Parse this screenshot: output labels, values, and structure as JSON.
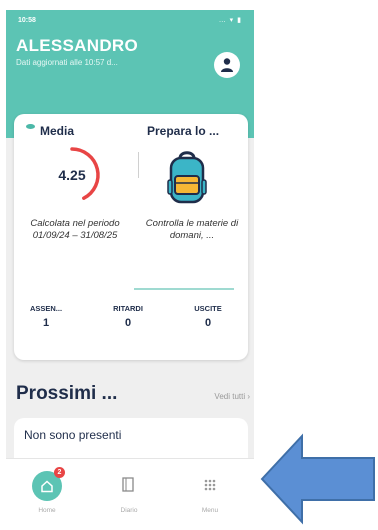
{
  "status_bar": {
    "time": "10:58",
    "icons": "… ▾ ▮"
  },
  "header": {
    "user_name": "ALESSANDRO",
    "updated_text": "Dati aggiornati alle 10:57 d..."
  },
  "media_card": {
    "title": "Media",
    "value": "4.25",
    "value_fraction": 0.425,
    "description": "Calcolata nel periodo 01/09/24 – 31/08/25"
  },
  "prepara_card": {
    "title": "Prepara lo ...",
    "description": "Controlla le materie di domani, ..."
  },
  "stats": [
    {
      "label": "ASSEN...",
      "value": "1"
    },
    {
      "label": "RITARDI",
      "value": "0"
    },
    {
      "label": "USCITE",
      "value": "0"
    }
  ],
  "upcoming": {
    "title": "Prossimi ...",
    "see_all": "Vedi tutti ›",
    "empty_text": "Non sono presenti"
  },
  "bottom_nav": {
    "home_label": "Home",
    "home_badge": "2",
    "diario_label": "Diario",
    "menu_label": "Menu"
  },
  "colors": {
    "accent": "#5cc4b4",
    "gauge": "#e84545",
    "arrow": "#5b8fd4"
  }
}
